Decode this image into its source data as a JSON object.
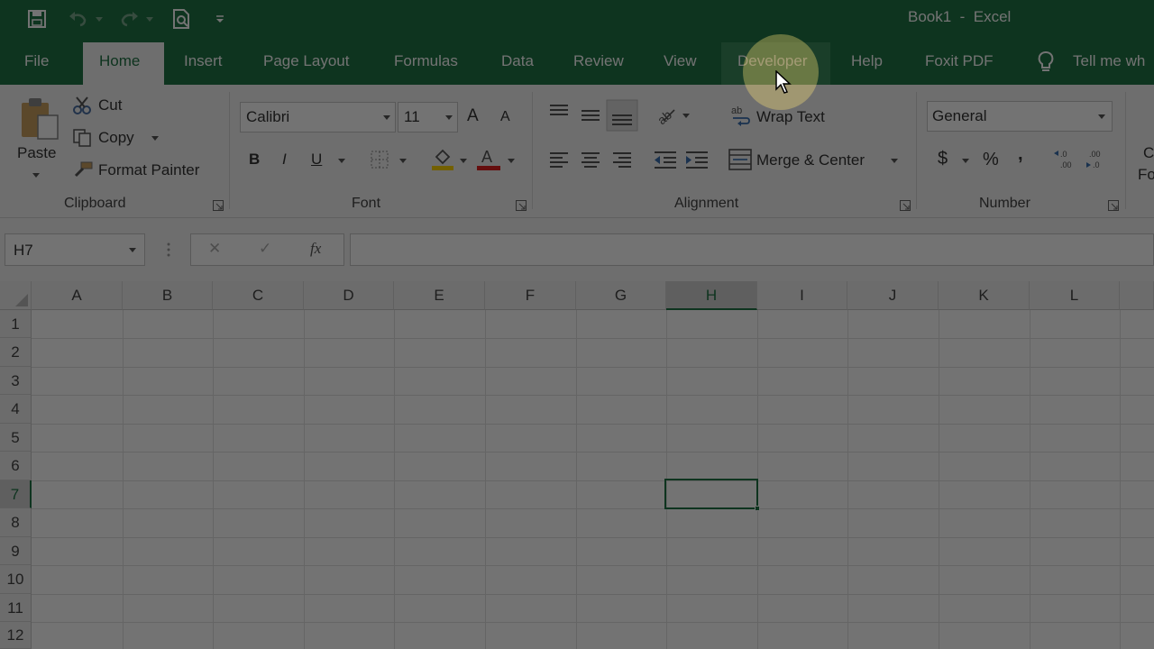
{
  "window": {
    "title": "Book1  -  Excel"
  },
  "tabs": [
    {
      "label": "File"
    },
    {
      "label": "Home"
    },
    {
      "label": "Insert"
    },
    {
      "label": "Page Layout"
    },
    {
      "label": "Formulas"
    },
    {
      "label": "Data"
    },
    {
      "label": "Review"
    },
    {
      "label": "View"
    },
    {
      "label": "Developer"
    },
    {
      "label": "Help"
    },
    {
      "label": "Foxit PDF"
    },
    {
      "label": "Tell me wh"
    }
  ],
  "clipboard": {
    "paste": "Paste",
    "cut": "Cut",
    "copy": "Copy",
    "format_painter": "Format Painter",
    "group": "Clipboard"
  },
  "font": {
    "name": "Calibri",
    "size": "11",
    "bold": "B",
    "italic": "I",
    "underline": "U",
    "grow": "A",
    "shrink": "A",
    "group": "Font"
  },
  "alignment": {
    "wrap_text": "Wrap Text",
    "merge_center": "Merge & Center",
    "group": "Alignment"
  },
  "number": {
    "format": "General",
    "currency": "$",
    "percent": "%",
    "comma": ",",
    "group": "Number"
  },
  "styles_partial": {
    "line1": "C",
    "line2": "Fo"
  },
  "formula_bar": {
    "name_box": "H7",
    "cancel": "✕",
    "enter": "✓",
    "fx": "fx",
    "value": ""
  },
  "grid": {
    "columns": [
      "A",
      "B",
      "C",
      "D",
      "E",
      "F",
      "G",
      "H",
      "I",
      "J",
      "K",
      "L"
    ],
    "rows": [
      "1",
      "2",
      "3",
      "4",
      "5",
      "6",
      "7",
      "8",
      "9",
      "10",
      "11",
      "12"
    ],
    "active_cell": "H7"
  },
  "colors": {
    "excel_green": "#217346"
  }
}
